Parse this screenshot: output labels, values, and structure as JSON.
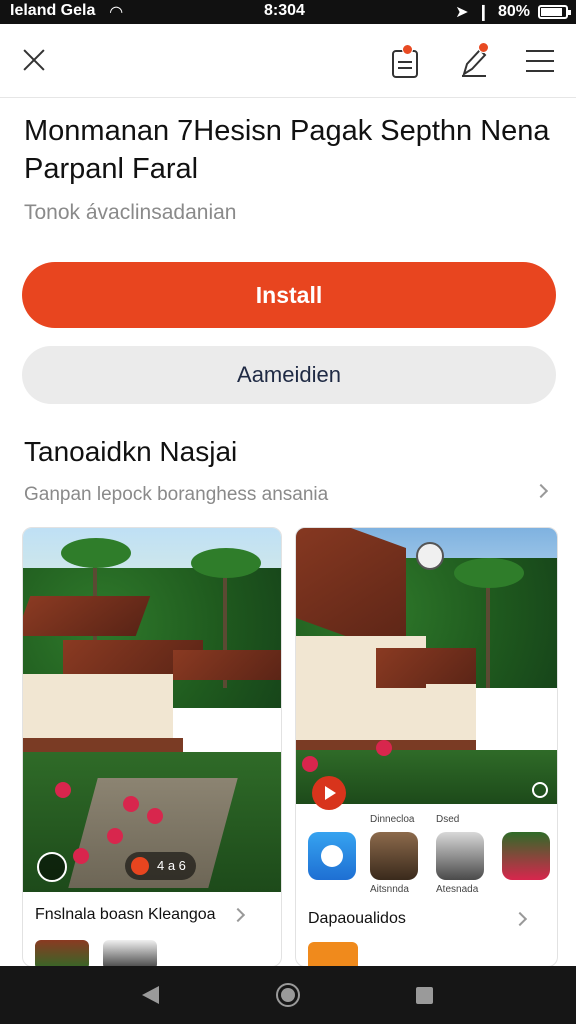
{
  "status_bar": {
    "carrier": "Ieland Gela",
    "time": "8:304",
    "battery": "80%",
    "battery_level": 0.8,
    "icons": [
      "wifi-icon",
      "location-arrow-icon",
      "signal-icon",
      "battery-icon"
    ]
  },
  "app_bar": {
    "icons": [
      "close-icon",
      "clipboard-icon",
      "pen-icon",
      "menu-icon"
    ],
    "accent_color": "#e84a22"
  },
  "app": {
    "title": "Monmanan 7Hesisn Pagak Septhn Nena Parpanl Faral",
    "subtitle": "Tonok ávaclinsadanian"
  },
  "actions": {
    "install_label": "Install",
    "secondary_label": "Aameidien",
    "install_color": "#e8451f"
  },
  "section": {
    "title": "Tanoaidkn Nasjai",
    "description": "Ganpan lepock boranghess ansania"
  },
  "cards": [
    {
      "chip_text": "4 a 6",
      "caption": "Fnslnala boasn  Kleangoa"
    },
    {
      "label_left": "Dinnecloa",
      "label_right": "Dsed",
      "apps": [
        {
          "label": ""
        },
        {
          "label": "Aitsnnda"
        },
        {
          "label": "Atesnada"
        },
        {
          "label": ""
        }
      ],
      "caption": "Dapaoualidos"
    }
  ],
  "nav_bar": {
    "icons": [
      "back-icon",
      "home-icon",
      "recents-icon"
    ]
  }
}
